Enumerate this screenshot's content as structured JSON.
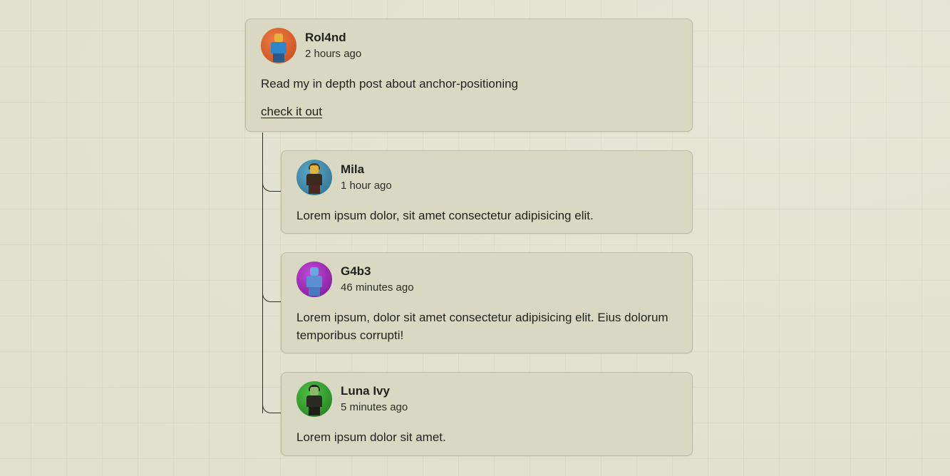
{
  "post": {
    "author": "Rol4nd",
    "time": "2 hours ago",
    "text": "Read my in depth post about anchor-positioning",
    "link_label": "check it out",
    "avatar_bg": "#d9572a"
  },
  "replies": [
    {
      "author": "Mila",
      "time": "1 hour ago",
      "text": "Lorem ipsum dolor, sit amet consectetur adipisicing elit.",
      "avatar_bg": "#3a86a8"
    },
    {
      "author": "G4b3",
      "time": "46 minutes ago",
      "text": "Lorem ipsum, dolor sit amet consectetur adipisicing elit. Eius dolorum temporibus corrupti!",
      "avatar_bg": "#9a1fb0"
    },
    {
      "author": "Luna Ivy",
      "time": "5 minutes ago",
      "text": "Lorem ipsum dolor sit amet.",
      "avatar_bg": "#2e9a2a"
    }
  ]
}
